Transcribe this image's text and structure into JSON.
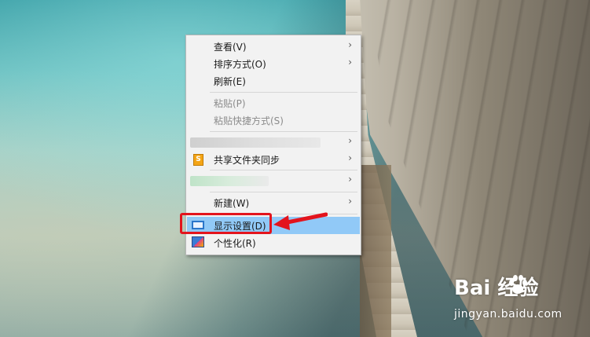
{
  "context_menu": {
    "items": [
      {
        "label": "查看(V)",
        "has_submenu": true,
        "disabled": false
      },
      {
        "label": "排序方式(O)",
        "has_submenu": true,
        "disabled": false
      },
      {
        "label": "刷新(E)",
        "has_submenu": false,
        "disabled": false
      },
      {
        "label": "粘贴(P)",
        "has_submenu": false,
        "disabled": true
      },
      {
        "label": "粘贴快捷方式(S)",
        "has_submenu": false,
        "disabled": true
      },
      {
        "label": "",
        "has_submenu": true,
        "blurred": true
      },
      {
        "label": "共享文件夹同步",
        "has_submenu": true,
        "icon": "share-sync-icon"
      },
      {
        "label": "",
        "has_submenu": true,
        "blurred": true
      },
      {
        "label": "新建(W)",
        "has_submenu": true,
        "disabled": false
      },
      {
        "label": "显示设置(D)",
        "has_submenu": false,
        "icon": "display-settings-icon",
        "highlighted": true
      },
      {
        "label": "个性化(R)",
        "has_submenu": false,
        "icon": "personalize-icon"
      }
    ],
    "submenu_arrow": "›",
    "highlight_color": "#91c9f7"
  },
  "annotation": {
    "color": "#e3141d"
  },
  "watermark": {
    "brand": "Bai  经验",
    "url": "jingyan.baidu.com"
  }
}
